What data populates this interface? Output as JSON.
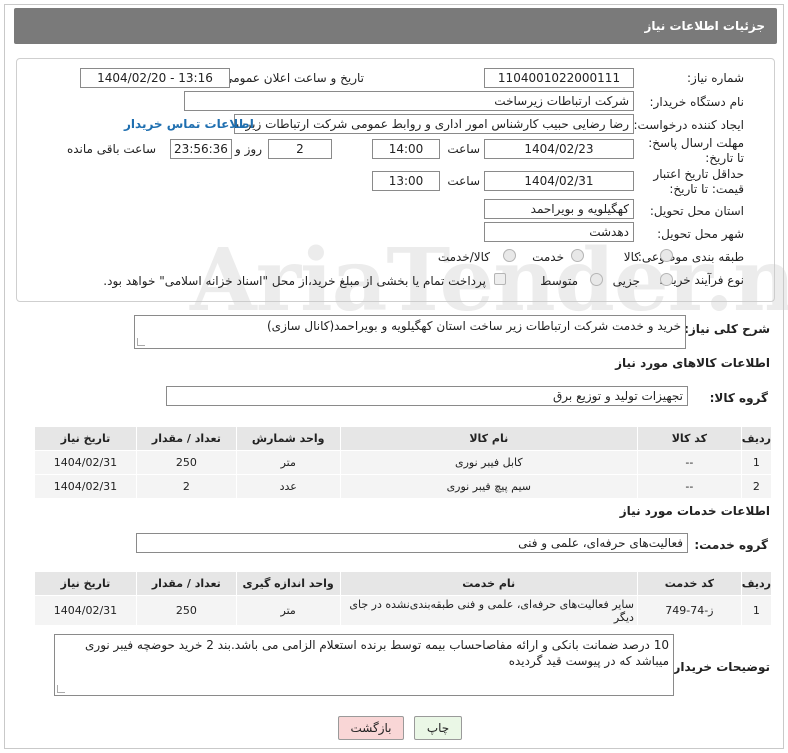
{
  "title": "جزئیات اطلاعات نیاز",
  "form": {
    "need_number_label": "شماره نیاز:",
    "need_number": "1104001022000111",
    "announce_label": "تاریخ و ساعت اعلان عمومی:",
    "announce_value": "1404/02/20 - 13:16",
    "buyer_org_label": "نام دستگاه خریدار:",
    "buyer_org": "شرکت ارتباطات زیرساخت",
    "creator_label": "ایجاد کننده درخواست:",
    "creator": "رضا رضایی حبیب کارشناس امور اداری و روابط عمومی شرکت ارتباطات زیرساخت",
    "contact_link": "اطلاعات تماس خریدار",
    "reply_deadline_label": "مهلت ارسال پاسخ: تا تاریخ:",
    "reply_date": "1404/02/23",
    "time_label": "ساعت",
    "reply_time": "14:00",
    "days_value": "2",
    "days_label": "روز و",
    "remaining_value": "23:56:36",
    "remaining_label": "ساعت باقی مانده",
    "price_deadline_label": "حداقل تاریخ اعتبار قیمت: تا تاریخ:",
    "price_date": "1404/02/31",
    "price_time": "13:00",
    "province_label": "استان محل تحویل:",
    "province": "کهگیلویه و بویراحمد",
    "city_label": "شهر محل تحویل:",
    "city": "دهدشت",
    "category_label": "طبقه بندی موضوعی:",
    "category_options": [
      "کالا",
      "خدمت",
      "کالا/خدمت"
    ],
    "process_label": "نوع فرآیند خرید :",
    "process_options": [
      "جزیی",
      "متوسط"
    ],
    "payment_note": "پرداخت تمام یا بخشی از مبلغ خرید،از محل \"اسناد خزانه اسلامی\" خواهد بود."
  },
  "description": {
    "label": "شرح کلی نیاز:",
    "value": "خرید و خدمت شرکت ارتباطات زیر ساخت استان کهگیلویه و بویراحمد(کانال سازی)"
  },
  "goods": {
    "section_title": "اطلاعات کالاهای مورد نیاز",
    "group_label": "گروه کالا:",
    "group_value": "تجهیزات تولید و توزیع برق",
    "headers": [
      "ردیف",
      "کد کالا",
      "نام کالا",
      "واحد شمارش",
      "تعداد / مقدار",
      "تاریخ نیاز"
    ],
    "rows": [
      [
        "1",
        "--",
        "کابل فیبر نوری",
        "متر",
        "250",
        "1404/02/31"
      ],
      [
        "2",
        "--",
        "سیم پیچ فیبر نوری",
        "عدد",
        "2",
        "1404/02/31"
      ]
    ]
  },
  "services": {
    "section_title": "اطلاعات خدمات مورد نیاز",
    "group_label": "گروه خدمت:",
    "group_value": "فعالیت‌های حرفه‌ای، علمی و فنی",
    "headers": [
      "ردیف",
      "کد خدمت",
      "نام خدمت",
      "واحد اندازه گیری",
      "تعداد / مقدار",
      "تاریخ نیاز"
    ],
    "rows": [
      [
        "1",
        "ز-74-749",
        "سایر فعالیت‌های حرفه‌ای، علمی و فنی طبقه‌بندی‌نشده در جای دیگر",
        "متر",
        "250",
        "1404/02/31"
      ]
    ]
  },
  "buyer_notes": {
    "label": "توضیحات خریدار:",
    "value": "10 درصد ضمانت بانکی و ارائه مفاصاحساب  بیمه توسط برنده استعلام الزامی می باشد.بند 2 خرید حوضچه فیبر نوری میباشد که در پیوست قید گردیده"
  },
  "buttons": {
    "print": "چاپ",
    "back": "بازگشت"
  },
  "colors": {
    "title_bar": "#7a7a7a",
    "link": "#1f6fb0",
    "back_button": "#f9d6d6",
    "print_button": "#eaf7e6"
  }
}
